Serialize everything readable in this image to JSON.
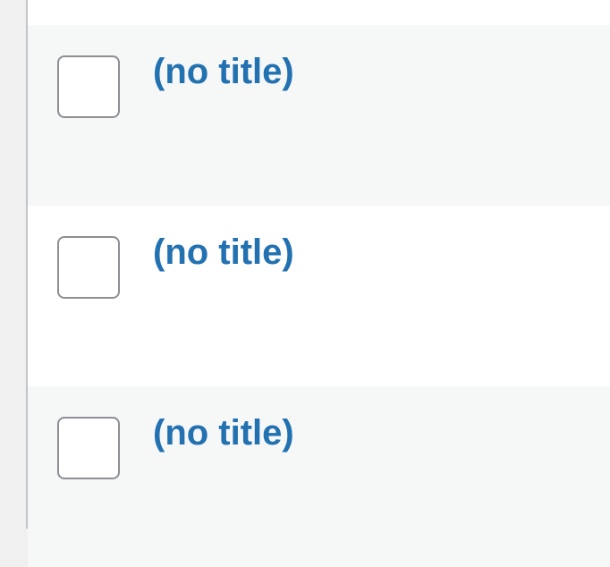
{
  "rows": [
    {
      "title": "(no title)",
      "checked": false
    },
    {
      "title": "(no title)",
      "checked": false
    },
    {
      "title": "(no title)",
      "checked": false
    }
  ],
  "colors": {
    "link": "#2271b1",
    "row_alt_bg": "#f6f7f7",
    "row_bg": "#ffffff",
    "checkbox_border": "#8c8f94",
    "outer_bg": "#f0f0f1"
  }
}
